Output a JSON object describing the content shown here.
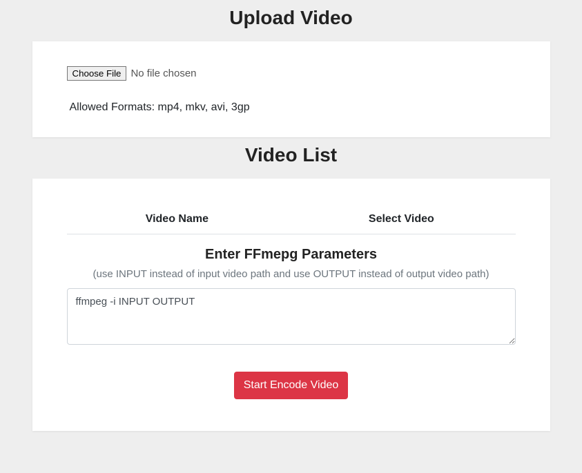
{
  "upload": {
    "heading": "Upload Video",
    "choose_file_label": "Choose File",
    "file_status": "No file chosen",
    "allowed_formats": "Allowed Formats: mp4, mkv, avi, 3gp"
  },
  "video_list": {
    "heading": "Video List",
    "columns": {
      "name": "Video Name",
      "select": "Select Video"
    }
  },
  "ffmpeg": {
    "heading": "Enter FFmepg Parameters",
    "hint": "(use INPUT instead of input video path and use OUTPUT instead of output video path)",
    "value": "ffmpeg -i INPUT OUTPUT"
  },
  "actions": {
    "start_encode": "Start Encode Video"
  }
}
